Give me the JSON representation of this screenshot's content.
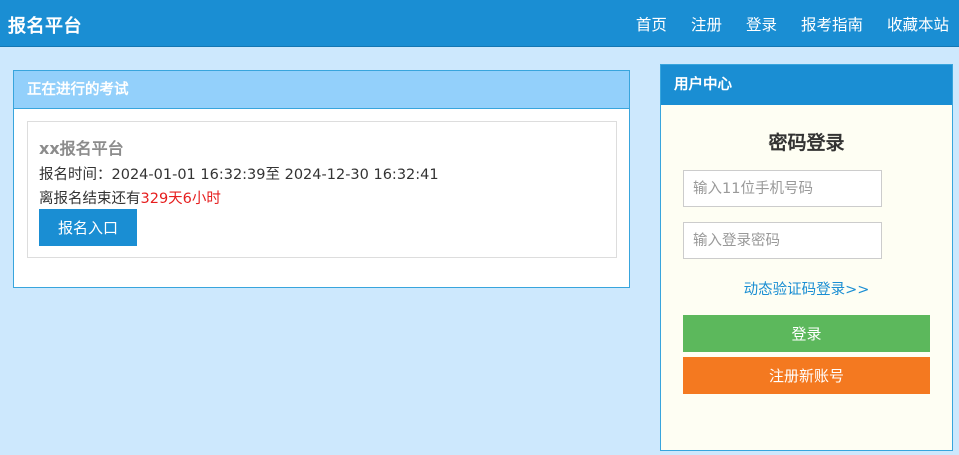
{
  "header": {
    "brand": "报名平台",
    "nav": [
      {
        "label": "首页"
      },
      {
        "label": "注册"
      },
      {
        "label": "登录"
      },
      {
        "label": "报考指南"
      },
      {
        "label": "收藏本站"
      }
    ]
  },
  "exam_panel": {
    "title": "正在进行的考试",
    "exam": {
      "name": "xx报名平台",
      "time_label": "报名时间：",
      "time_range": "2024-01-01 16:32:39至 2024-12-30 16:32:41",
      "remaining_prefix": "离报名结束还有",
      "remaining_value": "329天6小时",
      "enter_button": "报名入口"
    }
  },
  "user_center": {
    "title": "用户中心",
    "login_title": "密码登录",
    "phone_placeholder": "输入11位手机号码",
    "password_placeholder": "输入登录密码",
    "sms_login_link": "动态验证码登录>>",
    "login_button": "登录",
    "register_button": "注册新账号"
  },
  "colors": {
    "primary": "#1a8ed3",
    "page_background": "#cde8fd",
    "login_green": "#5cb85c",
    "register_orange": "#f47920",
    "countdown_red": "#e61e1e"
  }
}
